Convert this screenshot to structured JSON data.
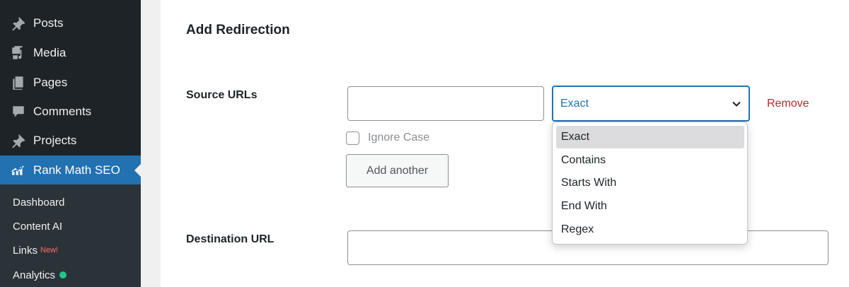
{
  "sidebar": {
    "menu": [
      {
        "label": "Posts",
        "icon": "pin-icon"
      },
      {
        "label": "Media",
        "icon": "media-icon"
      },
      {
        "label": "Pages",
        "icon": "pages-icon"
      },
      {
        "label": "Comments",
        "icon": "comment-icon"
      },
      {
        "label": "Projects",
        "icon": "pin-icon"
      },
      {
        "label": "Rank Math SEO",
        "icon": "rank-math-icon",
        "active": true
      }
    ],
    "submenu": [
      {
        "label": "Dashboard"
      },
      {
        "label": "Content AI"
      },
      {
        "label": "Links",
        "badge": "New!"
      },
      {
        "label": "Analytics",
        "status_color": "#1fc68b"
      }
    ]
  },
  "form": {
    "title": "Add Redirection",
    "source_label": "Source URLs",
    "source_value": "",
    "match_type": {
      "selected": "Exact",
      "options": [
        "Exact",
        "Contains",
        "Starts With",
        "End With",
        "Regex"
      ]
    },
    "remove_label": "Remove",
    "ignore_case_label": "Ignore Case",
    "ignore_case_checked": false,
    "add_another_label": "Add another",
    "destination_label": "Destination URL",
    "destination_value": ""
  },
  "colors": {
    "sidebar_bg": "#1d2327",
    "submenu_bg": "#2c3338",
    "accent": "#2271b1",
    "remove": "#b32d2e",
    "new_badge": "#ff6b6b"
  }
}
